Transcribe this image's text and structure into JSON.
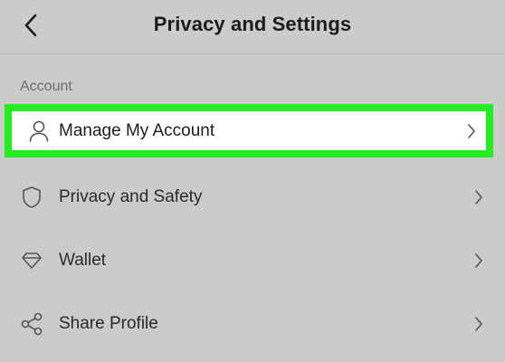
{
  "header": {
    "title": "Privacy and Settings",
    "back_icon": "chevron-left-icon"
  },
  "section": {
    "label": "Account"
  },
  "items": [
    {
      "label": "Manage My Account",
      "icon": "person-icon",
      "highlighted": true,
      "highlight_color": "#22ee22"
    },
    {
      "label": "Privacy and Safety",
      "icon": "shield-icon"
    },
    {
      "label": "Wallet",
      "icon": "diamond-icon"
    },
    {
      "label": "Share Profile",
      "icon": "share-icon"
    }
  ],
  "colors": {
    "background": "#cbcbcb",
    "highlight_border": "#22ee22",
    "text_primary": "#1c1c1c",
    "text_secondary": "#6e6e6e"
  }
}
